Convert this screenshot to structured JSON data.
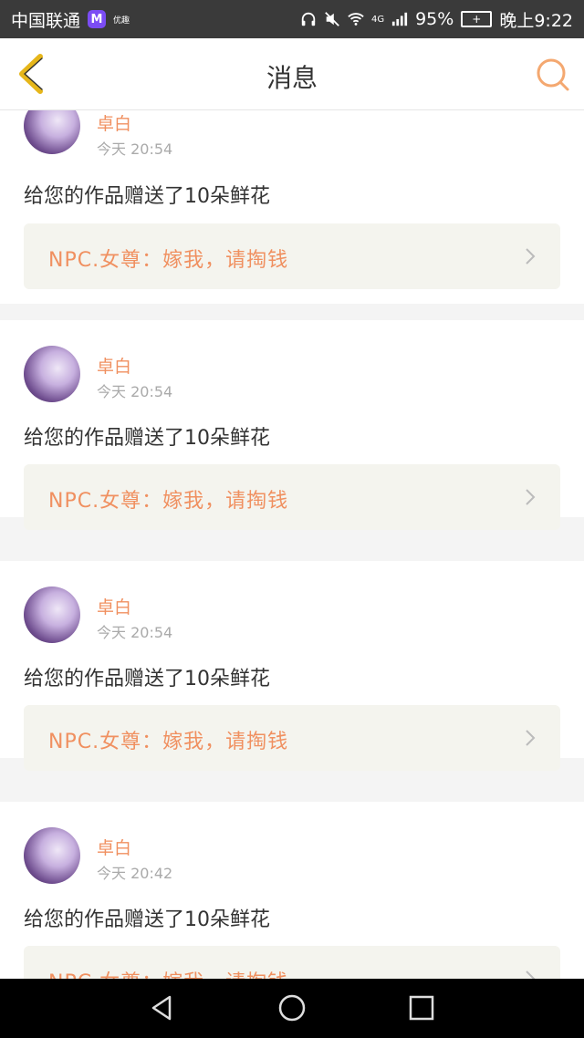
{
  "status_bar": {
    "carrier": "中国联通",
    "app_badge": "M",
    "small_label": "优趣",
    "network": "4G",
    "battery_pct": "95%",
    "time": "晚上9:22"
  },
  "header": {
    "title": "消息"
  },
  "messages": [
    {
      "sender": "卓白",
      "time": "今天 20:54",
      "text": "给您的作品赠送了10朵鲜花",
      "quote": "NPC.女尊：嫁我，请掏钱"
    },
    {
      "sender": "卓白",
      "time": "今天 20:54",
      "text": "给您的作品赠送了10朵鲜花",
      "quote": "NPC.女尊：嫁我，请掏钱"
    },
    {
      "sender": "卓白",
      "time": "今天 20:54",
      "text": "给您的作品赠送了10朵鲜花",
      "quote": "NPC.女尊：嫁我，请掏钱"
    },
    {
      "sender": "卓白",
      "time": "今天 20:42",
      "text": "给您的作品赠送了10朵鲜花",
      "quote": "NPC.女尊：嫁我，请掏钱"
    }
  ],
  "colors": {
    "accent": "#f09060",
    "status_bar_bg": "#3a3a3a",
    "quote_bg": "#f4f4ee"
  },
  "icons": {
    "back": "chevron-left-icon",
    "search": "search-icon",
    "quote_arrow": "chevron-right-icon",
    "nav_back": "triangle-back-icon",
    "nav_home": "circle-home-icon",
    "nav_recent": "square-recent-icon"
  }
}
